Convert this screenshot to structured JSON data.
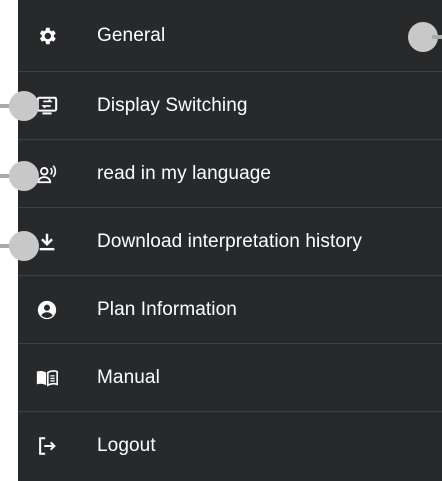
{
  "menu": {
    "items": [
      {
        "label": "General",
        "icon": "gear-icon"
      },
      {
        "label": "Display Switching",
        "icon": "display-switch-icon"
      },
      {
        "label": "read in my language",
        "icon": "voice-icon"
      },
      {
        "label": "Download interpretation history",
        "icon": "download-icon"
      },
      {
        "label": "Plan Information",
        "icon": "account-icon"
      },
      {
        "label": "Manual",
        "icon": "book-icon"
      },
      {
        "label": "Logout",
        "icon": "logout-icon"
      }
    ]
  },
  "colors": {
    "menu_background": "#28292b",
    "divider": "#3f4043",
    "text": "#ffffff",
    "callout": "#c8c8c8"
  }
}
